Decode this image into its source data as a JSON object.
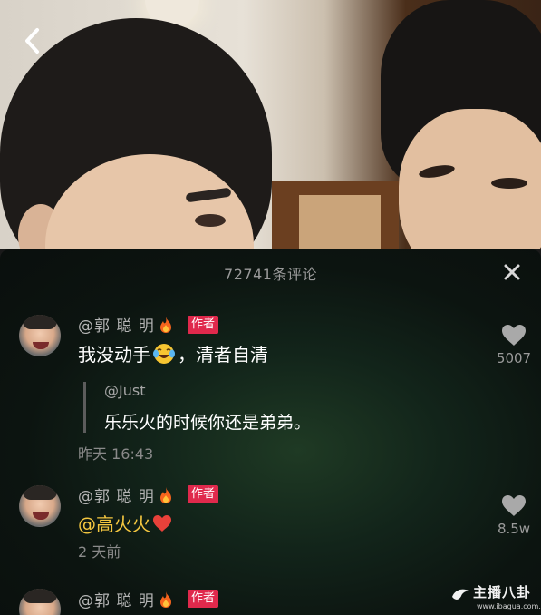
{
  "header": {
    "comment_count": "72741条评论",
    "back_icon": "chevron-left-icon",
    "close_icon": "close-icon"
  },
  "colors": {
    "author_badge": "#e0294c",
    "mention": "#f3c640",
    "heart_red": "#e8413a"
  },
  "comments": [
    {
      "username": "@郭 聪 明",
      "badge": "作者",
      "text_before_emoji": "我没动手",
      "emoji": "laughing-tears-icon",
      "text_after_emoji": "，清者自清",
      "reply": {
        "username": "@Just",
        "text": "乐乐火的时候你还是弟弟。"
      },
      "time": "昨天 16:43",
      "likes": "5007"
    },
    {
      "username": "@郭 聪 明",
      "badge": "作者",
      "mention": "@高火火",
      "emoji": "red-heart-icon",
      "time": "2 天前",
      "likes": "8.5w"
    },
    {
      "username": "@郭 聪 明",
      "badge": "作者"
    }
  ],
  "watermark": {
    "text": "主播八卦",
    "url": "www.ibagua.com.cn"
  }
}
